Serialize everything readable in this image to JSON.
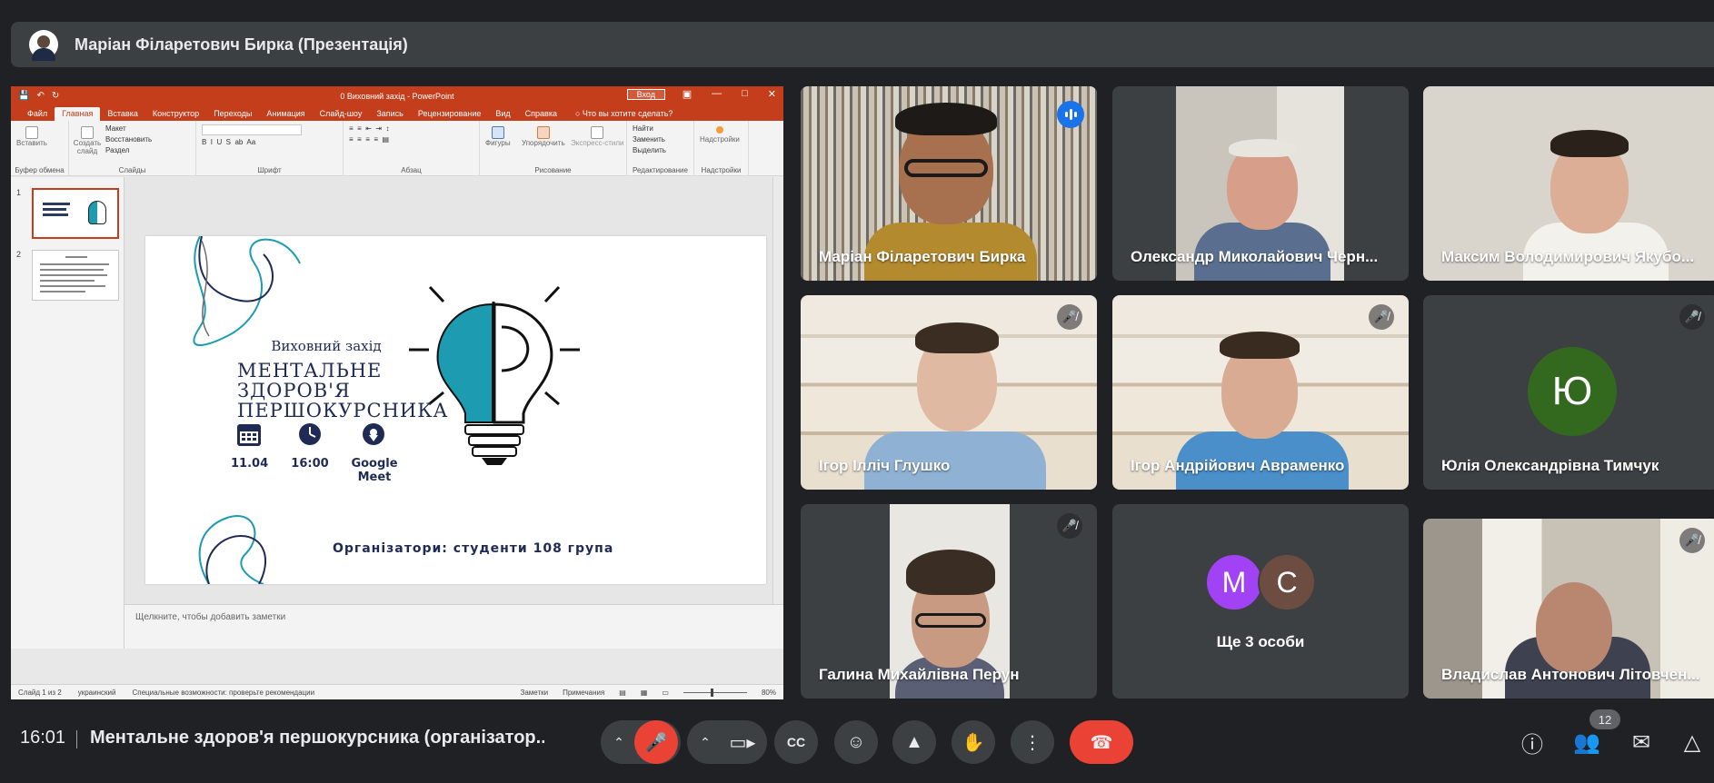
{
  "presenter_bar": {
    "title": "Маріан Філаретович Бирка (Презентація)"
  },
  "powerpoint": {
    "doc_title": "0 Виховний захід  -  PowerPoint",
    "sign_in": "Вход",
    "tabs": [
      "Файл",
      "Главная",
      "Вставка",
      "Конструктор",
      "Переходы",
      "Анимация",
      "Слайд-шоу",
      "Запись",
      "Рецензирование",
      "Вид",
      "Справка"
    ],
    "active_tab": "Главная",
    "tell_me": "Что вы хотите сделать?",
    "ribbon": {
      "clipboard": {
        "label": "Буфер обмена",
        "paste": "Вставить"
      },
      "slides": {
        "label": "Слайды",
        "new_slide": "Создать слайд",
        "layout": "Макет",
        "reset": "Восстановить",
        "section": "Раздел"
      },
      "font": {
        "label": "Шрифт"
      },
      "paragraph": {
        "label": "Абзац"
      },
      "drawing": {
        "label": "Рисование",
        "shapes": "Фигуры",
        "arrange": "Упорядочить",
        "quick_styles": "Экспресс-стили"
      },
      "editing": {
        "label": "Редактирование",
        "find": "Найти",
        "replace": "Заменить",
        "select": "Выделить"
      },
      "addins": {
        "label": "Надстройки",
        "button": "Надстройки"
      }
    },
    "thumb_numbers": [
      "1",
      "2"
    ],
    "slide": {
      "event": "Виховний захід",
      "title_lines": [
        "МЕНТАЛЬНЕ",
        "ЗДОРОВ'Я",
        "ПЕРШОКУРСНИКА"
      ],
      "date": "11.04",
      "time": "16:00",
      "place": "Google Meet",
      "organizers": "Організатори: студенти 108 група"
    },
    "notes_placeholder": "Щелкните, чтобы добавить заметки",
    "status": {
      "slide_of": "Слайд 1 из 2",
      "language": "украинский",
      "accessibility": "Специальные возможности: проверьте рекомендации",
      "notes": "Заметки",
      "comments": "Примечания",
      "zoom": "80%"
    }
  },
  "participants": [
    {
      "name": "Маріан Філаретович Бирка",
      "muted": false,
      "speaking": true
    },
    {
      "name": "Олександр Миколайович Черн...",
      "muted": false,
      "speaking": false
    },
    {
      "name": "Максим Володимирович Якубо...",
      "muted": false,
      "speaking": false
    },
    {
      "name": "Ігор Ілліч Глушко",
      "muted": true,
      "speaking": false
    },
    {
      "name": "Ігор Андрійович Авраменко",
      "muted": true,
      "speaking": false
    },
    {
      "name": "Юлія Олександрівна Тимчук",
      "muted": true,
      "speaking": false,
      "initial": "Ю",
      "avatar_color": "#33691e"
    },
    {
      "name": "Галина Михайлівна Перун",
      "muted": true,
      "speaking": false
    },
    {
      "name": "Владислав Антонович Літовчен...",
      "muted": true,
      "speaking": false
    }
  ],
  "others_tile": {
    "initials": [
      "M",
      "C"
    ],
    "colors": [
      "#a142f4",
      "#6d4c41"
    ],
    "label": "Ще 3 особи"
  },
  "bottom_bar": {
    "time": "16:01",
    "meeting_title": "Ментальне здоров'я першокурсника (організатор...",
    "participant_count": "12",
    "icons": [
      "caret-up-icon",
      "mic-off-icon",
      "caret-up-icon",
      "camera-icon",
      "captions-icon",
      "emoji-icon",
      "present-icon",
      "raise-hand-icon",
      "more-icon",
      "end-call-icon",
      "info-icon",
      "people-icon",
      "chat-icon",
      "activities-icon"
    ]
  },
  "colors": {
    "accent_red": "#ea4335",
    "active_speaker": "#8ab4f8",
    "ppt_brand": "#c43e1c",
    "slide_navy": "#1f2b55",
    "slide_teal": "#1d9bb0"
  }
}
